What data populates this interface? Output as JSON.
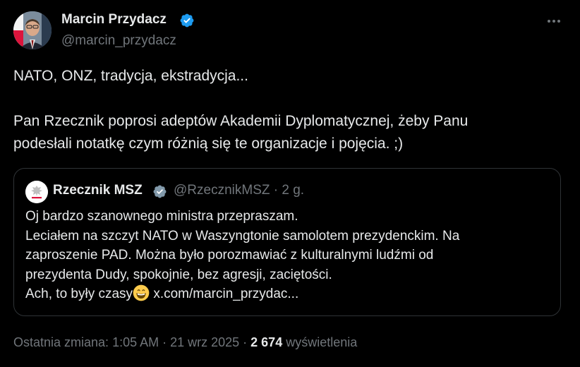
{
  "author": {
    "name": "Marcin Przydacz",
    "handle": "@marcin_przydacz",
    "verified_color": "#1d9bf0"
  },
  "more_icon": "ellipsis-icon",
  "tweet": {
    "line1": "NATO, ONZ, tradycja, ekstradycja...",
    "line2": "Pan Rzecznik poprosi adeptów Akademii Dyplomatycznej, żeby Panu",
    "line3": "podesłali notatkę czym różnią się te organizacje i pojęcia. ;)"
  },
  "quote": {
    "name": "Rzecznik MSZ",
    "handle": "@RzecznikMSZ",
    "separator": " · ",
    "time": "2 g.",
    "verified_color": "#829aab",
    "lines": [
      "Oj bardzo szanownego ministra przepraszam.",
      "Leciałem na szczyt NATO w Waszyngtonie samolotem prezydenckim. Na",
      "zaproszenie PAD. Można było porozmawiać z kulturalnymi ludźmi od",
      "prezydenta Dudy, spokojnie, bez agresji, zaciętości."
    ],
    "last_line_text": "Ach, to były czasy",
    "emoji": "grinning-face-emoji",
    "link_text": " x.com/marcin_przydac..."
  },
  "meta": {
    "edited_time": "Ostatnia zmiana: 1:05 AM · 21 wrz 2025 · ",
    "views_count": "2 674",
    "views_label": " wyświetlenia"
  }
}
